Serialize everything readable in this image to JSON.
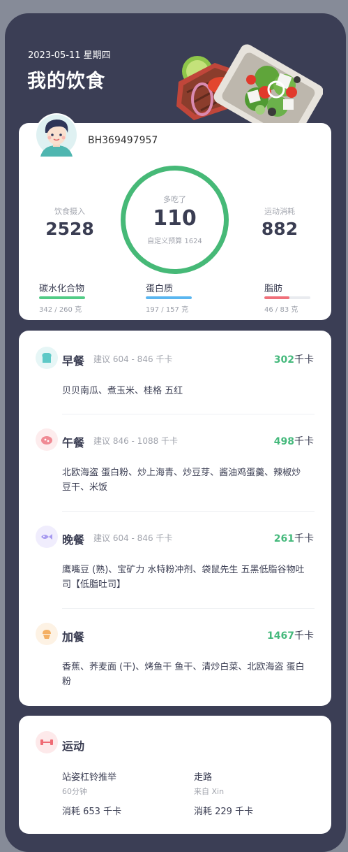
{
  "header": {
    "date": "2023-05-11 星期四",
    "title": "我的饮食"
  },
  "summary": {
    "user_id": "BH369497957",
    "intake_label": "饮食摄入",
    "intake_value": "2528",
    "ring_label": "多吃了",
    "ring_value": "110",
    "ring_sub": "自定义预算 1624",
    "exercise_label": "运动消耗",
    "exercise_value": "882",
    "macros": [
      {
        "name": "碳水化合物",
        "value": "342 / 260 克",
        "fraction": 1.0,
        "color": "#52cc86"
      },
      {
        "name": "蛋白质",
        "value": "197 / 157 克",
        "fraction": 1.0,
        "color": "#5ab6f0"
      },
      {
        "name": "脂肪",
        "value": "46 / 83 克",
        "fraction": 0.55,
        "color": "#f0707a"
      }
    ]
  },
  "meals": [
    {
      "name": "早餐",
      "suggest": "建议 604 - 846 千卡",
      "kcal": "302",
      "unit": "千卡",
      "foods": "贝贝南瓜、煮玉米、桂格 五红",
      "icon": "toast-icon",
      "icon_color": "#5ec9c7",
      "icon_bg": "#e6f6f6"
    },
    {
      "name": "午餐",
      "suggest": "建议 846 - 1088 千卡",
      "kcal": "498",
      "unit": "千卡",
      "foods": "北欧海盗 蛋白粉、炒上海青、炒豆芽、酱油鸡蛋羹、辣椒炒豆干、米饭",
      "icon": "meat-icon",
      "icon_color": "#f08a94",
      "icon_bg": "#fdeced"
    },
    {
      "name": "晚餐",
      "suggest": "建议 604 - 846 千卡",
      "kcal": "261",
      "unit": "千卡",
      "foods": "鹰嘴豆 (熟)、宝矿力 水特粉冲剂、袋鼠先生 五黑低脂谷物吐司【低脂吐司】",
      "icon": "fish-icon",
      "icon_color": "#a79af0",
      "icon_bg": "#f0edfd"
    },
    {
      "name": "加餐",
      "suggest": "",
      "kcal": "1467",
      "unit": "千卡",
      "foods": "香蕉、荞麦面 (干)、烤鱼干 鱼干、清炒白菜、北欧海盗 蛋白粉",
      "icon": "cupcake-icon",
      "icon_color": "#f4b064",
      "icon_bg": "#fdf2e4"
    }
  ],
  "exercise": {
    "title": "运动",
    "icon": "dumbbell-icon",
    "items": [
      {
        "name": "站姿杠铃推举",
        "sub": "60分钟",
        "cal": "消耗 653 千卡"
      },
      {
        "name": "走路",
        "sub": "来自 Xin",
        "cal": "消耗 229 千卡"
      }
    ]
  }
}
